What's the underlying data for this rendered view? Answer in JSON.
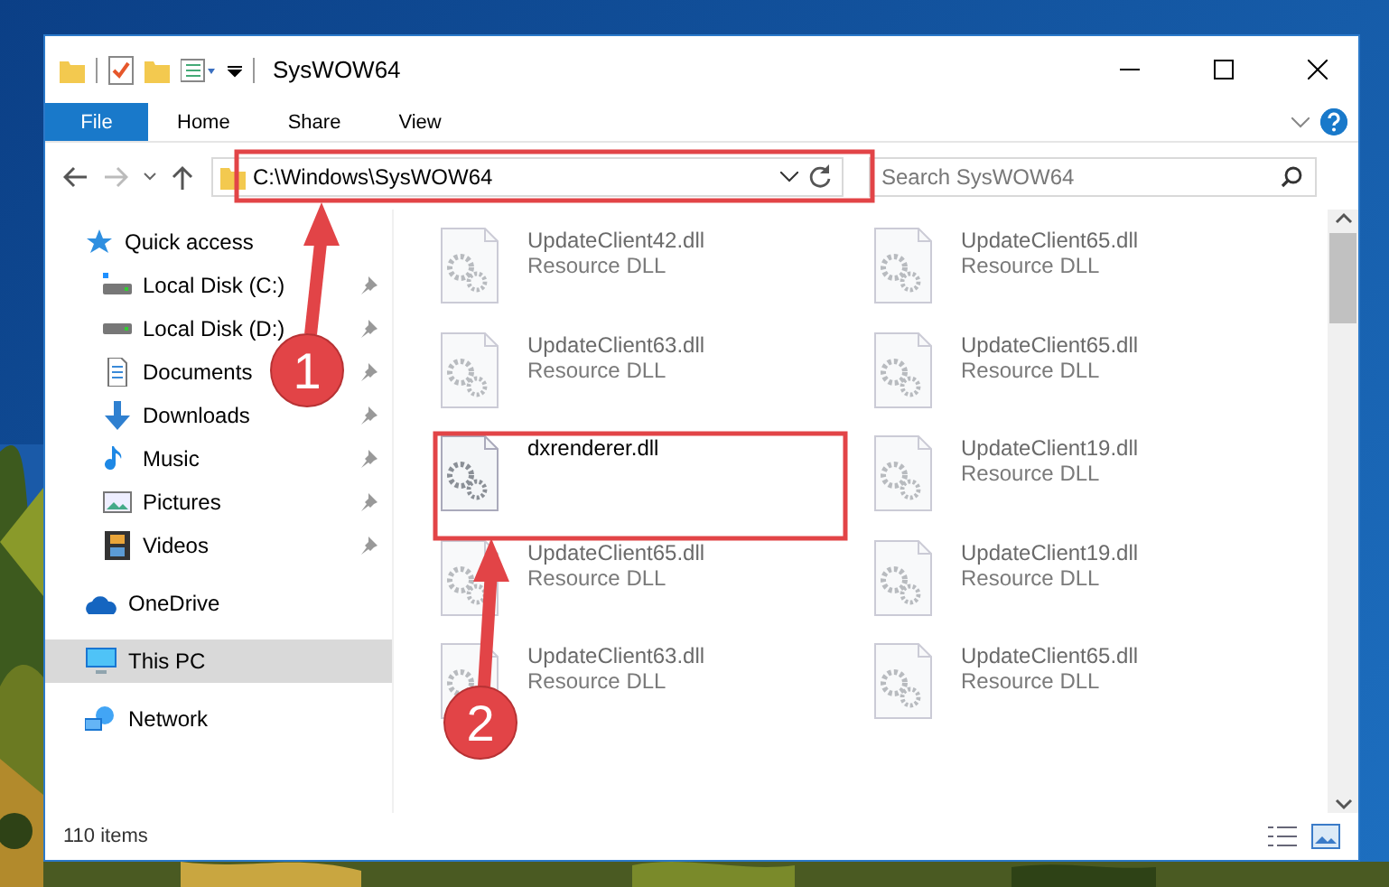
{
  "window": {
    "title": "SysWOW64"
  },
  "ribbon": {
    "tabs": [
      {
        "label": "File",
        "kind": "menu"
      },
      {
        "label": "Home",
        "kind": "tab"
      },
      {
        "label": "Share",
        "kind": "tab"
      },
      {
        "label": "View",
        "kind": "tab"
      }
    ]
  },
  "address": {
    "path": "C:\\Windows\\SysWOW64"
  },
  "search": {
    "placeholder": "Search SysWOW64"
  },
  "sidebar": {
    "items": [
      {
        "label": "Quick access",
        "selected": false,
        "children": [
          {
            "label": "Local Disk (C:)",
            "pinned": true
          },
          {
            "label": "Local Disk (D:)",
            "pinned": true
          },
          {
            "label": "Documents",
            "pinned": true
          },
          {
            "label": "Downloads",
            "pinned": true
          },
          {
            "label": "Music",
            "pinned": true
          },
          {
            "label": "Pictures",
            "pinned": true
          },
          {
            "label": "Videos",
            "pinned": true
          }
        ]
      },
      {
        "label": "OneDrive",
        "selected": false
      },
      {
        "label": "This PC",
        "selected": true
      },
      {
        "label": "Network",
        "selected": false
      }
    ]
  },
  "files": [
    {
      "name": "UpdateClient42.dll",
      "type": "Resource DLL",
      "blurred": true
    },
    {
      "name": "UpdateClient65.dll",
      "type": "Resource DLL",
      "blurred": true
    },
    {
      "name": "UpdateClient63.dll",
      "type": "Resource DLL",
      "blurred": true
    },
    {
      "name": "UpdateClient65.dll",
      "type": "Resource DLL",
      "blurred": true
    },
    {
      "name": "dxrenderer.dll",
      "blurred": false
    },
    {
      "name": "UpdateClient19.dll",
      "type": "Resource DLL",
      "blurred": true
    },
    {
      "name": "UpdateClient65.dll",
      "type": "Resource DLL",
      "blurred": true
    },
    {
      "name": "UpdateClient19.dll",
      "type": "Resource DLL",
      "blurred": true
    },
    {
      "name": "UpdateClient63.dll",
      "type": "Resource DLL",
      "blurred": true
    },
    {
      "name": "UpdateClient65.dll",
      "type": "Resource DLL",
      "blurred": true
    }
  ],
  "status_bar": {
    "count": "110 items"
  },
  "annotations": [
    {
      "label": "1"
    },
    {
      "label": "2"
    }
  ]
}
